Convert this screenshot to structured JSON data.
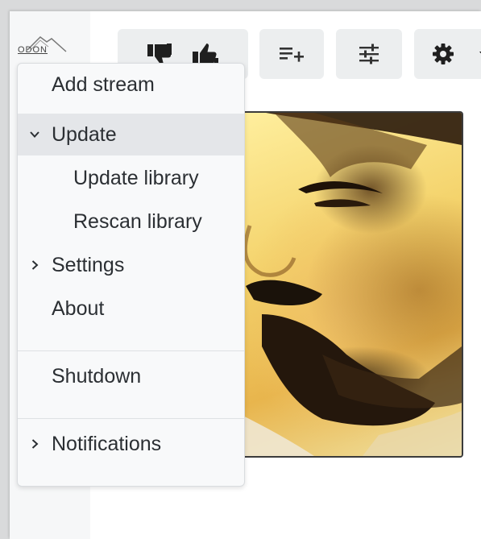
{
  "logo": {
    "text": "ODON",
    "icon": "mountain-logo"
  },
  "toolbar": {
    "buttons": [
      {
        "name": "rating",
        "icons": [
          "thumbs-down-icon",
          "thumbs-up-icon"
        ]
      },
      {
        "name": "add-to-queue",
        "icon": "playlist-add-icon"
      },
      {
        "name": "adjust",
        "icon": "tune-sliders-icon"
      },
      {
        "name": "settings",
        "icon": "gear-icon",
        "has_dropdown": true
      }
    ]
  },
  "menu": {
    "items": [
      {
        "label": "Add stream"
      },
      {
        "label": "Update",
        "expanded": true,
        "active": true
      },
      {
        "label": "Update library",
        "sub": true
      },
      {
        "label": "Rescan library",
        "sub": true
      },
      {
        "label": "Settings",
        "expandable": true
      },
      {
        "label": "About"
      },
      {
        "label": "Shutdown"
      },
      {
        "label": "Notifications",
        "expandable": true
      }
    ]
  },
  "colors": {
    "menu_bg": "#f8f9fa",
    "menu_active": "#e4e6e9",
    "text": "#2b2f33",
    "toolbar_button": "#eceeef"
  }
}
